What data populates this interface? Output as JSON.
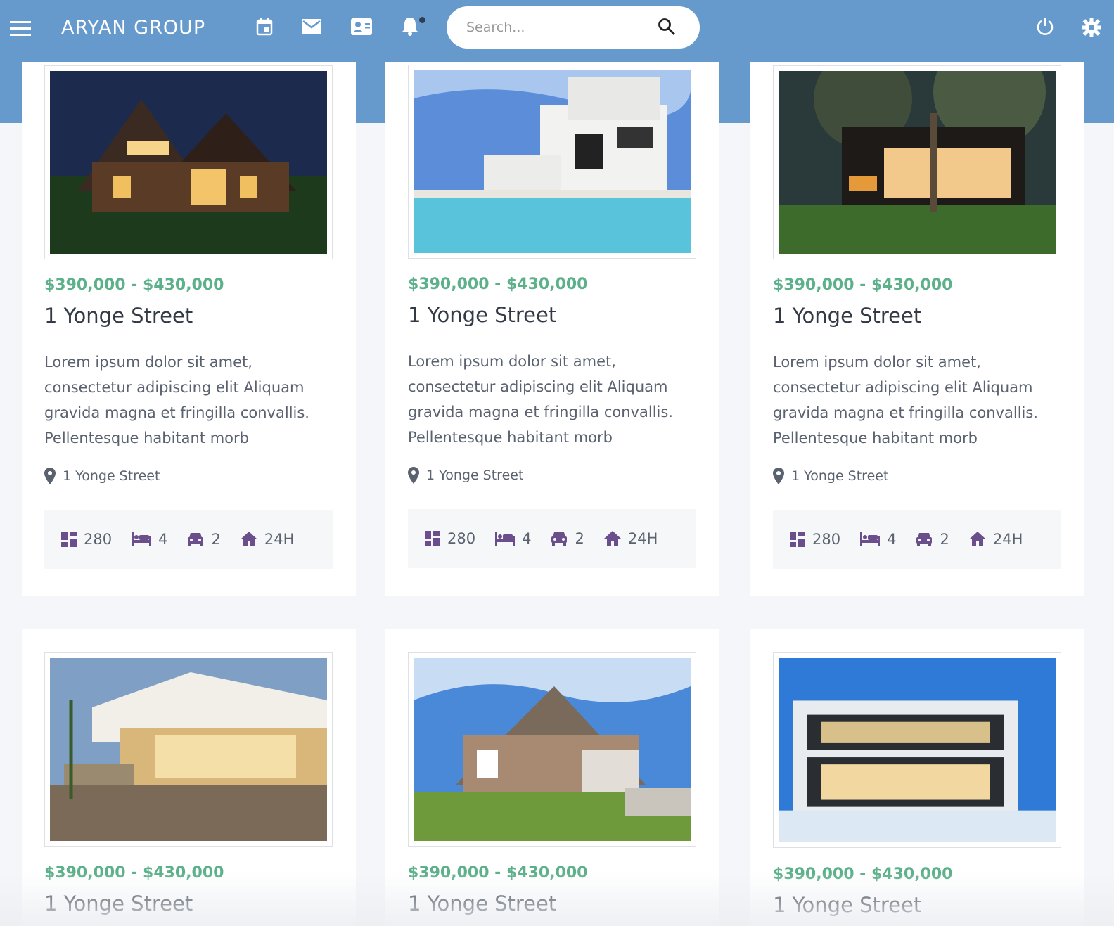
{
  "header": {
    "brand": "ARYAN GROUP",
    "search_placeholder": "Search..."
  },
  "colors": {
    "header_bg": "#6699cc",
    "price": "#5cb08a",
    "icon_purple": "#6b4f8c"
  },
  "icons": [
    "menu-icon",
    "calendar-icon",
    "mail-icon",
    "contact-card-icon",
    "bell-icon",
    "search-icon",
    "power-icon",
    "gear-icon",
    "location-pin-icon",
    "area-icon",
    "bed-icon",
    "car-icon",
    "home-icon"
  ],
  "listings": [
    {
      "price": "$390,000 - $430,000",
      "title": "1 Yonge Street",
      "description": "Lorem ipsum dolor sit amet, consectetur adipiscing elit Aliquam gravida magna et fringilla convallis. Pellentesque habitant morb",
      "address": "1 Yonge Street",
      "area": "280",
      "beds": "4",
      "parking": "2",
      "access": "24H"
    },
    {
      "price": "$390,000 - $430,000",
      "title": "1 Yonge Street",
      "description": "Lorem ipsum dolor sit amet, consectetur adipiscing elit Aliquam gravida magna et fringilla convallis. Pellentesque habitant morb",
      "address": "1 Yonge Street",
      "area": "280",
      "beds": "4",
      "parking": "2",
      "access": "24H"
    },
    {
      "price": "$390,000 - $430,000",
      "title": "1 Yonge Street",
      "description": "Lorem ipsum dolor sit amet, consectetur adipiscing elit Aliquam gravida magna et fringilla convallis. Pellentesque habitant morb",
      "address": "1 Yonge Street",
      "area": "280",
      "beds": "4",
      "parking": "2",
      "access": "24H"
    },
    {
      "price": "$390,000 - $430,000",
      "title": "1 Yonge Street"
    },
    {
      "price": "$390,000 - $430,000",
      "title": "1 Yonge Street"
    },
    {
      "price": "$390,000 - $430,000",
      "title": "1 Yonge Street"
    }
  ]
}
